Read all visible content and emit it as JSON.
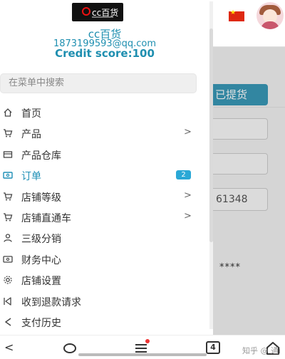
{
  "background": {
    "pickup_button_label": "已提货",
    "field_value": "61348",
    "masked_text": "****"
  },
  "drawer": {
    "logo_text": "cc百货",
    "shop_name": "cc百货",
    "email": "1873199593@qq.com",
    "credit": "Credit score:100",
    "search_placeholder": "在菜单中搜索",
    "menu": [
      {
        "label": "首页",
        "icon": "home-icon",
        "chevron": false,
        "badge": null,
        "active": false
      },
      {
        "label": "产品",
        "icon": "cart-icon",
        "chevron": true,
        "badge": null,
        "active": false
      },
      {
        "label": "产品仓库",
        "icon": "warehouse-icon",
        "chevron": false,
        "badge": null,
        "active": false
      },
      {
        "label": "订单",
        "icon": "order-icon",
        "chevron": false,
        "badge": "2",
        "active": true
      },
      {
        "label": "店铺等级",
        "icon": "cart-icon",
        "chevron": true,
        "badge": null,
        "active": false
      },
      {
        "label": "店铺直通车",
        "icon": "cart-icon",
        "chevron": true,
        "badge": null,
        "active": false
      },
      {
        "label": "三级分销",
        "icon": "user-icon",
        "chevron": false,
        "badge": null,
        "active": false
      },
      {
        "label": "财务中心",
        "icon": "wallet-icon",
        "chevron": false,
        "badge": null,
        "active": false
      },
      {
        "label": "店铺设置",
        "icon": "gear-icon",
        "chevron": false,
        "badge": null,
        "active": false
      },
      {
        "label": "收到退款请求",
        "icon": "refund-icon",
        "chevron": false,
        "badge": null,
        "active": false
      },
      {
        "label": "支付历史",
        "icon": "history-icon",
        "chevron": false,
        "badge": null,
        "active": false
      }
    ],
    "chevron_glyph": ">"
  },
  "navbar": {
    "back_glyph": "<",
    "tabs_count": "4",
    "watermark": "知乎 @ 通i"
  },
  "colors": {
    "accent": "#1f8fb0",
    "badge": "#2aa8d6",
    "button": "#3a99b8"
  }
}
